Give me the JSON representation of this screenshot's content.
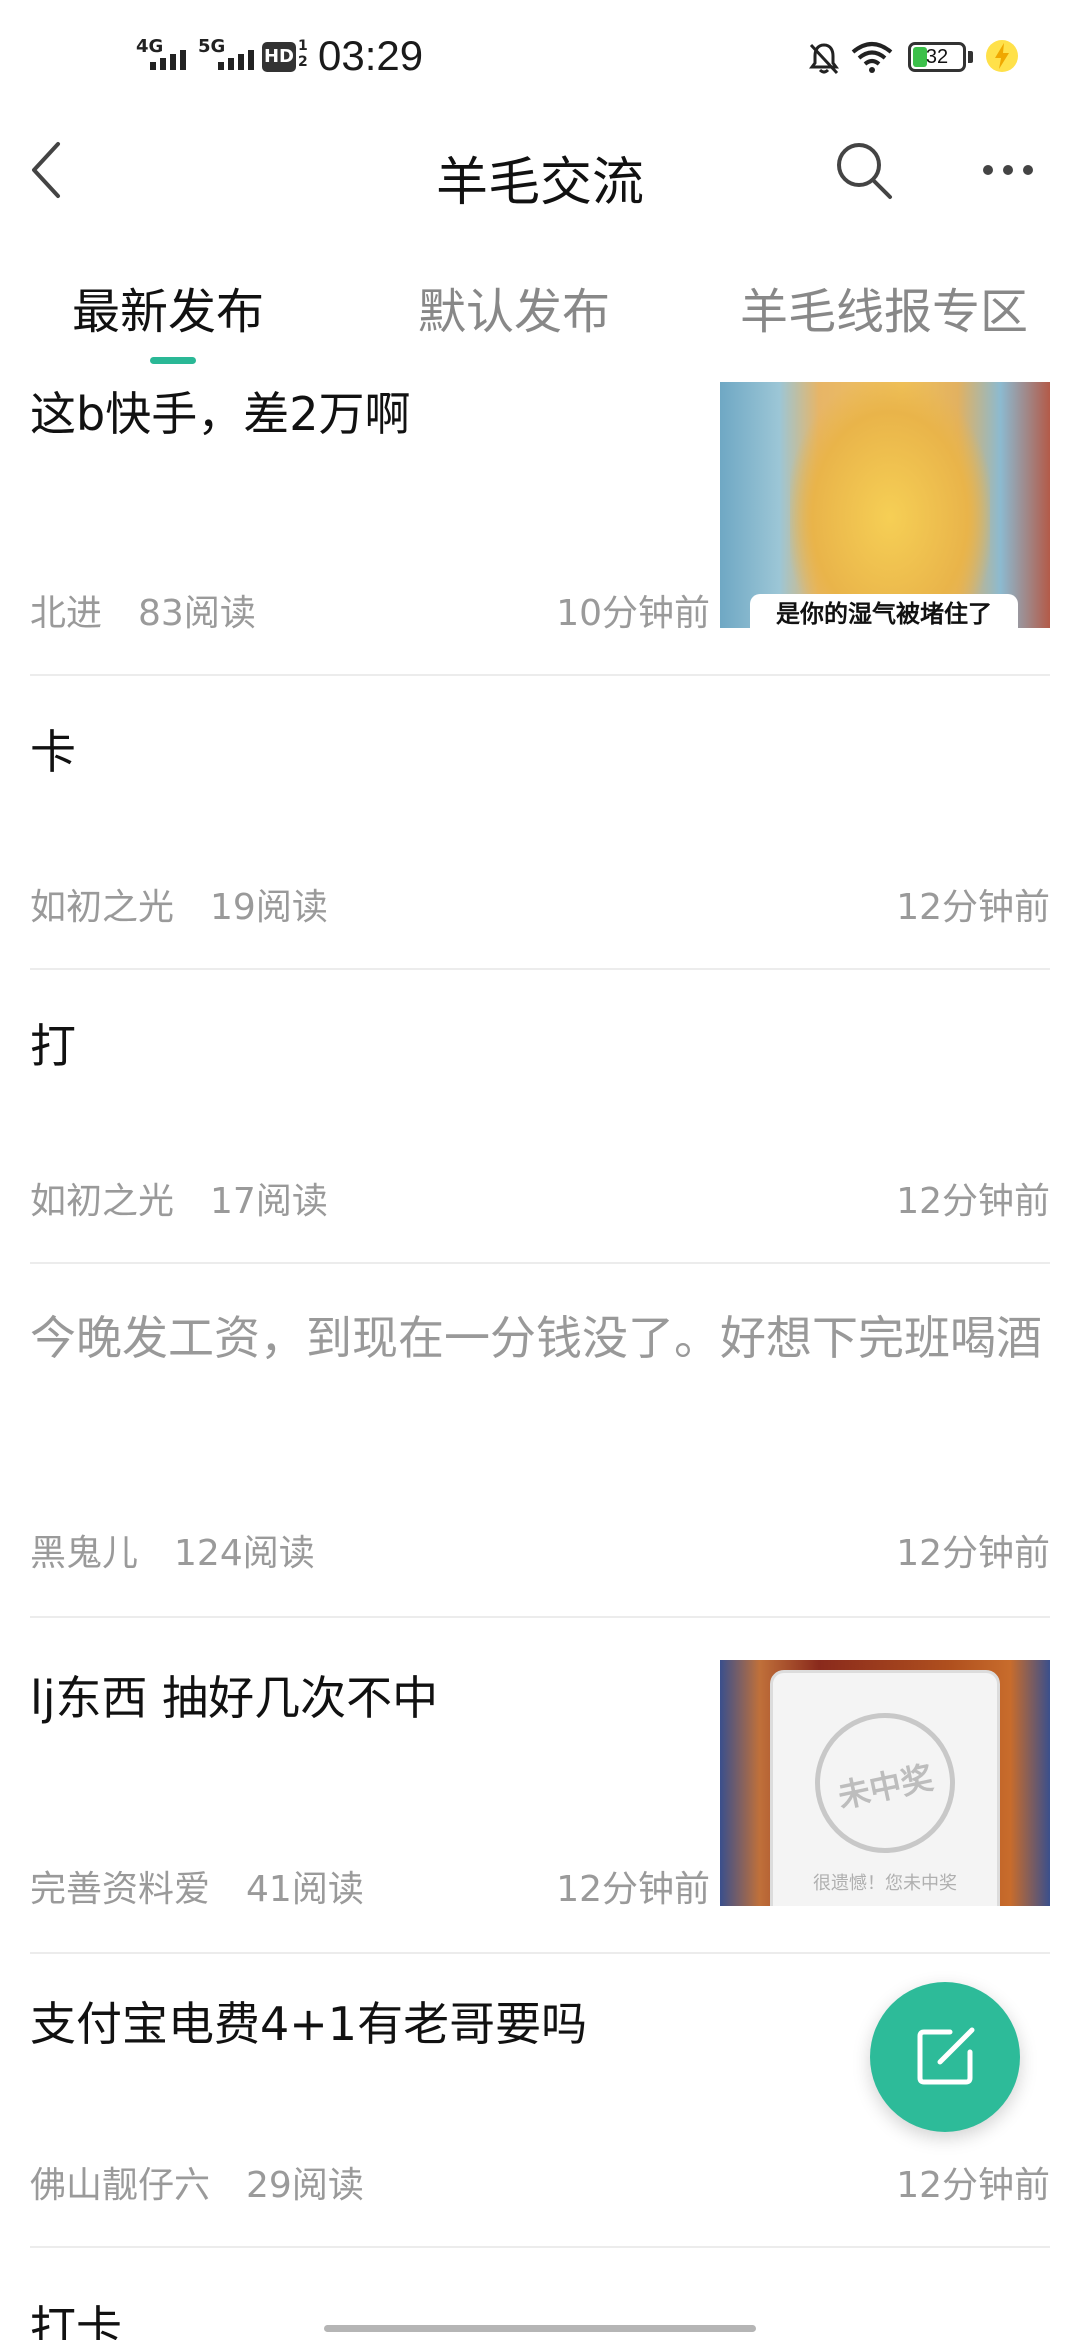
{
  "status_bar": {
    "time": "03:29",
    "signal_1": "4G",
    "signal_2": "5G",
    "hd": "HD",
    "hd_sub": "1\n2",
    "battery": "32",
    "icons": [
      "mute-bell-icon",
      "wifi-icon",
      "battery-icon",
      "charging-icon"
    ]
  },
  "nav": {
    "title": "羊毛交流",
    "icons": [
      "back-arrow-icon",
      "search-icon",
      "more-icon"
    ]
  },
  "tabs": [
    {
      "label": "最新发布",
      "active": true
    },
    {
      "label": "默认发布",
      "active": false
    },
    {
      "label": "羊毛线报专区",
      "active": false
    }
  ],
  "posts": [
    {
      "title": "这b快手，差2万啊",
      "author": "北进",
      "reads": "83阅读",
      "time": "10分钟前",
      "thumb_caption": "是你的湿气被堵住了"
    },
    {
      "title": "卡",
      "author": "如初之光",
      "reads": "19阅读",
      "time": "12分钟前"
    },
    {
      "title": "打",
      "author": "如初之光",
      "reads": "17阅读",
      "time": "12分钟前"
    },
    {
      "title": "今晚发工资，到现在一分钱没了。好想下完班喝酒",
      "author": "黑鬼儿",
      "reads": "124阅读",
      "time": "12分钟前"
    },
    {
      "title": "lj东西 抽好几次不中",
      "author": "完善资料爱",
      "reads": "41阅读",
      "time": "12分钟前",
      "thumb_stamp": "未中奖",
      "thumb_caption": "很遗憾！您未中奖"
    },
    {
      "title": "支付宝电费4+1有老哥要吗",
      "author": "佛山靓仔六",
      "reads": "29阅读",
      "time": "12分钟前"
    },
    {
      "title": "打卡"
    }
  ],
  "fab": {
    "icon": "compose-icon"
  },
  "colors": {
    "accent": "#2dbb99",
    "meta_gray": "#9a9a9a",
    "divider": "#ececec"
  }
}
